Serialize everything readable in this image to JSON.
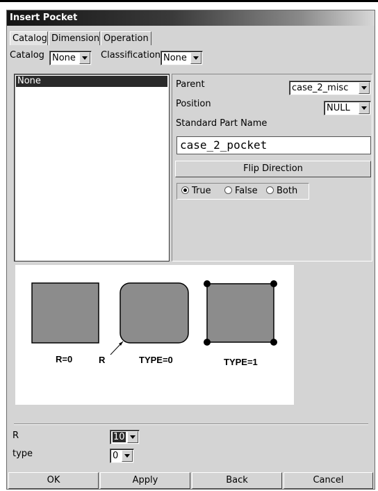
{
  "window": {
    "title": "Insert Pocket"
  },
  "tabs": [
    {
      "label": "Catalog",
      "active": true
    },
    {
      "label": "Dimension",
      "active": false
    },
    {
      "label": "Operation",
      "active": false
    }
  ],
  "filters": {
    "catalog_label": "Catalog",
    "catalog_value": "None",
    "classification_label": "Classification",
    "classification_value": "None"
  },
  "list": {
    "items": [
      "None"
    ],
    "selected_index": 0
  },
  "props": {
    "parent_label": "Parent",
    "parent_value": "case_2_misc",
    "position_label": "Position",
    "position_value": "NULL",
    "standard_part_name_label": "Standard Part Name",
    "standard_part_name_value": "case_2_pocket",
    "flip_direction_label": "Flip Direction",
    "radio": {
      "options": [
        "True",
        "False",
        "Both"
      ],
      "selected": "True"
    }
  },
  "preview": {
    "labels": {
      "r0": "R=0",
      "r": "R",
      "type0": "TYPE=0",
      "type1": "TYPE=1"
    },
    "colors": {
      "fill": "#8c8c8c",
      "stroke": "#000000"
    }
  },
  "params": {
    "r_label": "R",
    "r_value": "10",
    "type_label": "type",
    "type_value": "0"
  },
  "buttons": {
    "ok": "OK",
    "apply": "Apply",
    "back": "Back",
    "cancel": "Cancel"
  }
}
